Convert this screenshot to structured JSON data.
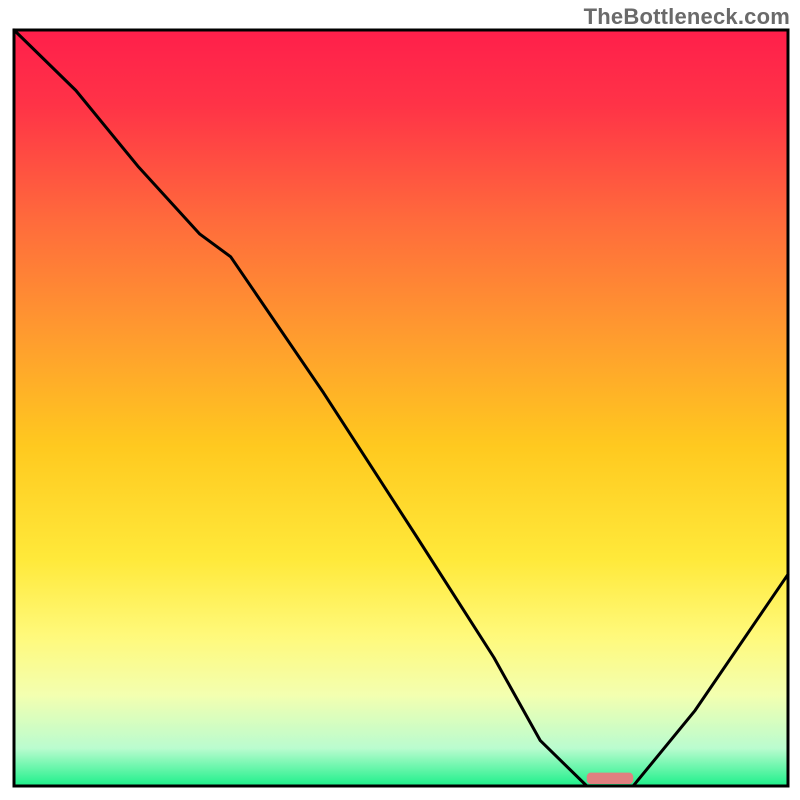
{
  "watermark": "TheBottleneck.com",
  "chart_data": {
    "type": "line",
    "title": "",
    "xlabel": "",
    "ylabel": "",
    "xlim": [
      0,
      100
    ],
    "ylim": [
      0,
      100
    ],
    "gradient_stops": [
      {
        "offset": 0.0,
        "color": "#ff1f4b"
      },
      {
        "offset": 0.1,
        "color": "#ff3347"
      },
      {
        "offset": 0.25,
        "color": "#ff6a3c"
      },
      {
        "offset": 0.4,
        "color": "#ff9a2f"
      },
      {
        "offset": 0.55,
        "color": "#ffc91f"
      },
      {
        "offset": 0.7,
        "color": "#ffe93a"
      },
      {
        "offset": 0.8,
        "color": "#fff97a"
      },
      {
        "offset": 0.88,
        "color": "#f3ffb0"
      },
      {
        "offset": 0.95,
        "color": "#bafccf"
      },
      {
        "offset": 1.0,
        "color": "#1df08a"
      }
    ],
    "series": [
      {
        "name": "bottleneck-curve",
        "color": "#000000",
        "x": [
          0,
          8,
          16,
          24,
          28,
          40,
          52,
          62,
          68,
          74,
          80,
          88,
          96,
          100
        ],
        "y": [
          100,
          92,
          82,
          73,
          70,
          52,
          33,
          17,
          6,
          0,
          0,
          10,
          22,
          28
        ]
      }
    ],
    "marker": {
      "name": "optimal-range",
      "color": "#e08080",
      "x_start": 74,
      "x_end": 80,
      "y": 0,
      "height": 1.5
    }
  }
}
